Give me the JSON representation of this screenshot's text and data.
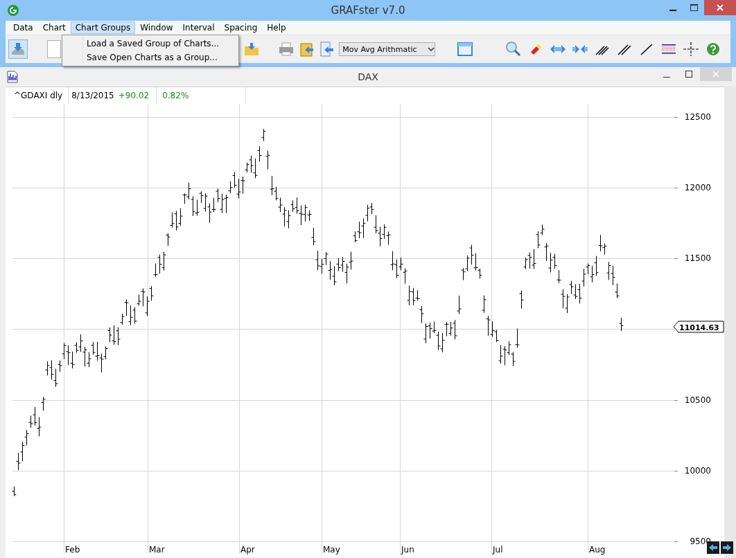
{
  "window": {
    "title": "GRAFster v7.0"
  },
  "menu": [
    {
      "label": "Data",
      "selected": false
    },
    {
      "label": "Chart",
      "selected": false
    },
    {
      "label": "Chart Groups",
      "selected": true
    },
    {
      "label": "Window",
      "selected": false
    },
    {
      "label": "Interval",
      "selected": false
    },
    {
      "label": "Spacing",
      "selected": false
    },
    {
      "label": "Help",
      "selected": false
    }
  ],
  "dropdown": {
    "items": [
      "Load a Saved Group of Charts...",
      "Save Open Charts as a Group..."
    ]
  },
  "toolbar": {
    "indicator_select": {
      "value": "Mov Avg Arithmatic"
    }
  },
  "chart_window": {
    "title": "DAX",
    "header": {
      "symbol": "^GDAXI dly",
      "date": "8/13/2015",
      "change": "+90.02",
      "percent": "0.82%"
    },
    "price_levels": [
      "12500",
      "12000",
      "11500",
      "10500",
      "10000",
      "9500"
    ],
    "months": [
      "Feb",
      "Mar",
      "Apr",
      "May",
      "Jun",
      "Jul",
      "Aug"
    ],
    "last_price": "11014.63"
  }
}
